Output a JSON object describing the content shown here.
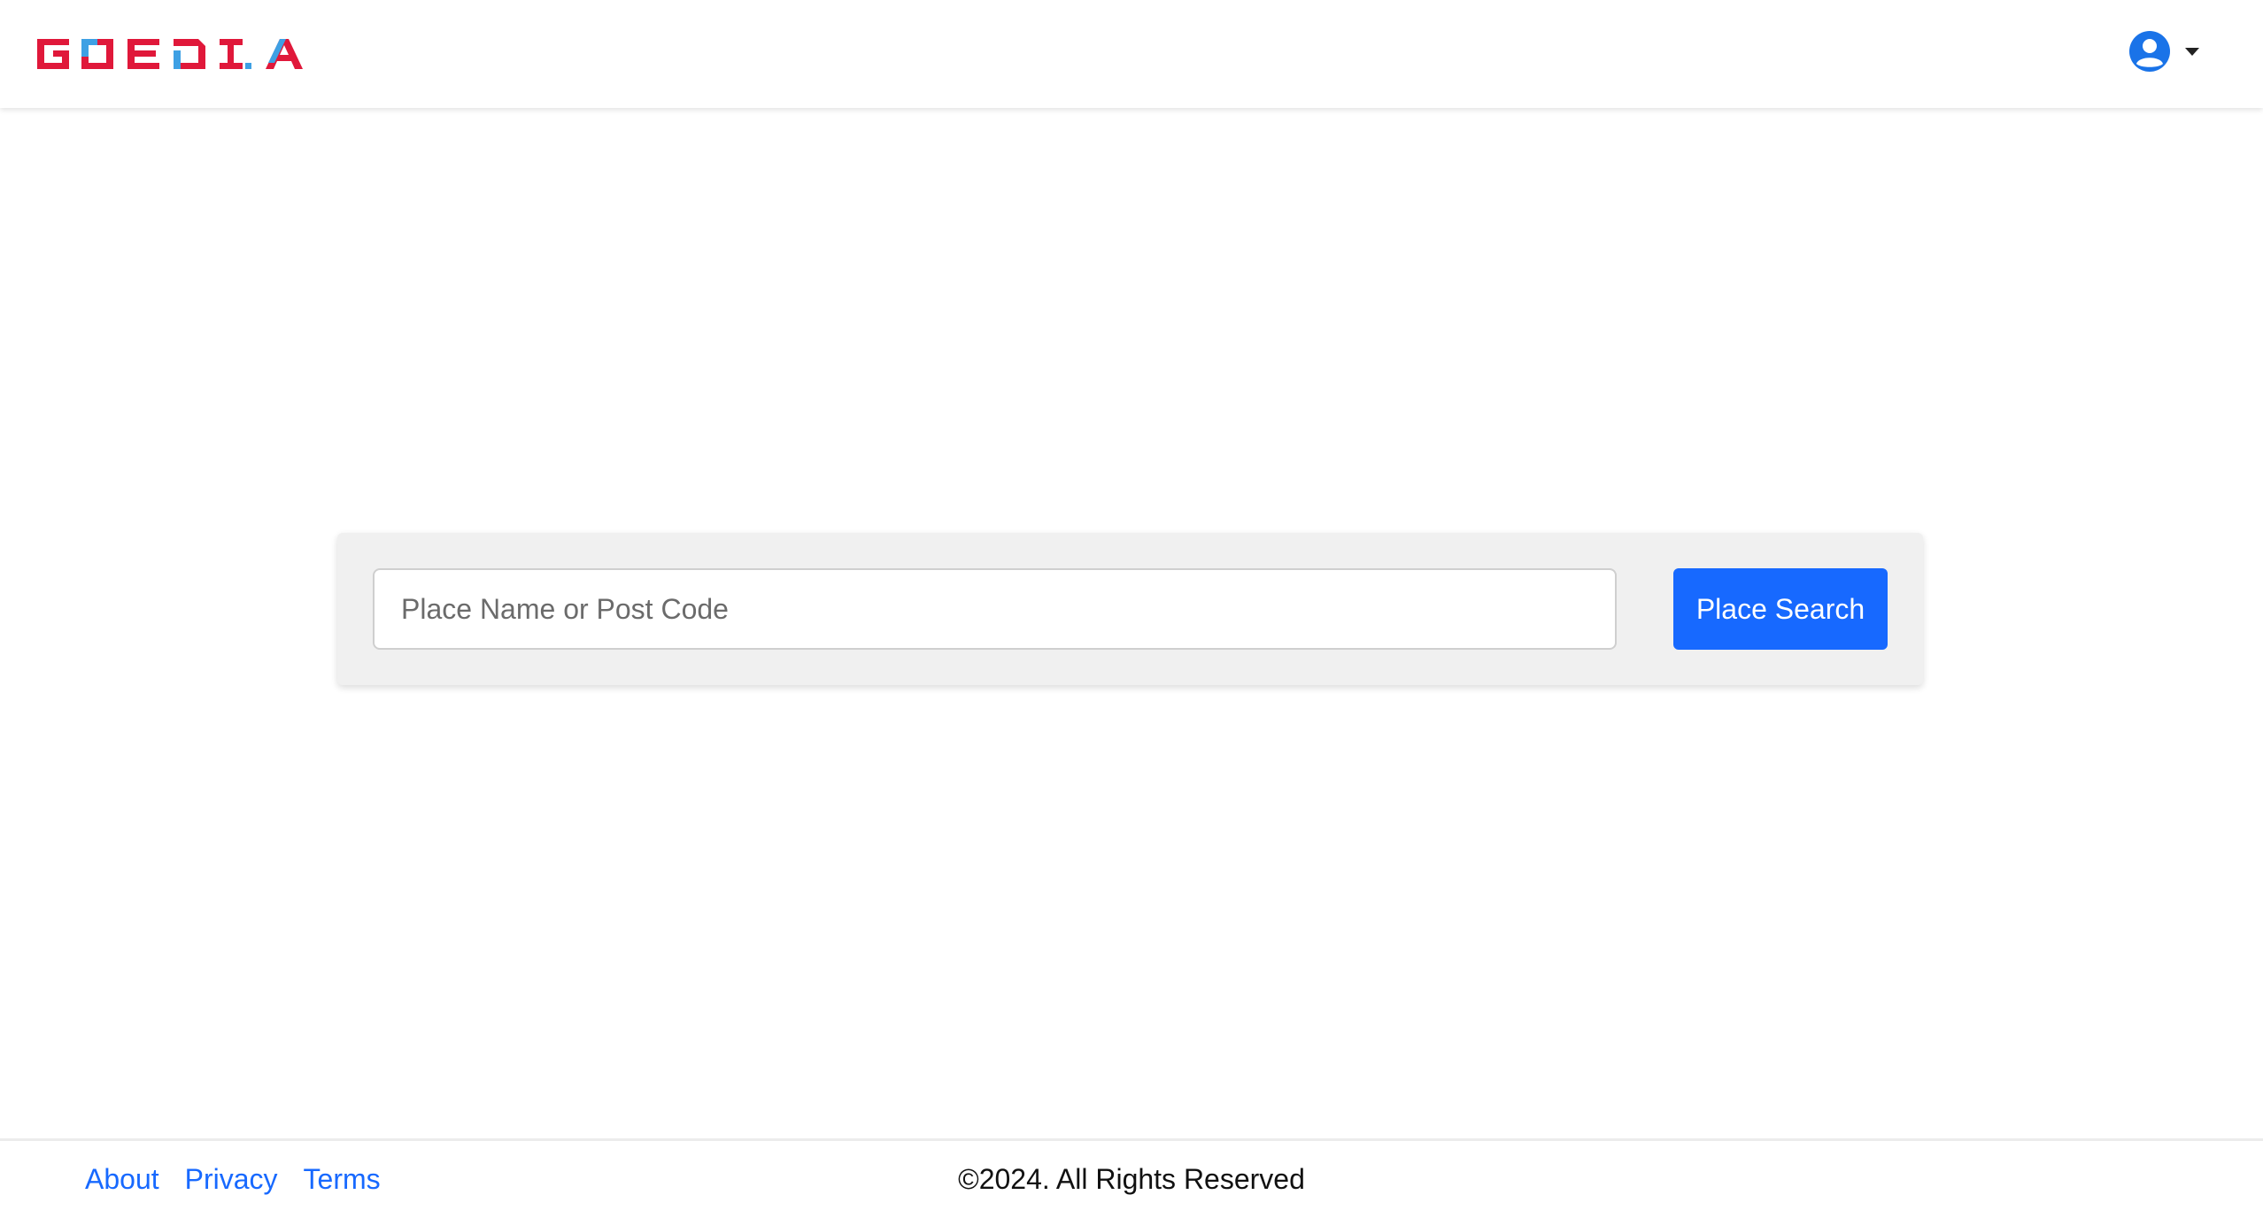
{
  "header": {
    "logo_text": "GOEDIA",
    "logo_colors": {
      "primary": "#e0183a",
      "secondary": "#3ea0e4"
    },
    "user_icon": "user-circle-icon",
    "dropdown_icon": "caret-down-icon"
  },
  "search": {
    "placeholder": "Place Name or Post Code",
    "value": "",
    "button_label": "Place Search"
  },
  "footer": {
    "links": [
      {
        "label": "About"
      },
      {
        "label": "Privacy"
      },
      {
        "label": "Terms"
      }
    ],
    "copyright": "©2024. All Rights Reserved"
  },
  "colors": {
    "accent": "#1769ff",
    "panel_bg": "#f0f0f0",
    "user_icon": "#1a73e8"
  }
}
